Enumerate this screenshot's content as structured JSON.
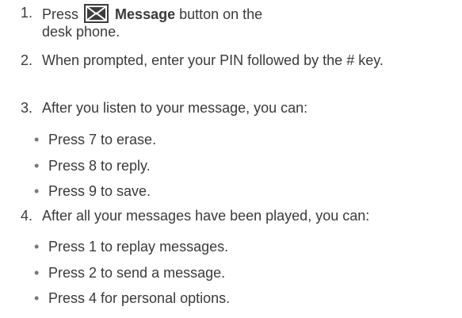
{
  "steps": [
    {
      "number": "1.",
      "before": "Press",
      "button_label": "Message",
      "after_line1": " button on the",
      "after_line2": "desk phone.",
      "icon": "envelope-icon"
    },
    {
      "number": "2.",
      "text": "When prompted, enter your PIN followed by the # key."
    },
    {
      "number": "3.",
      "text": "After you listen to your message, you can:",
      "bullets": [
        "Press 7 to erase.",
        "Press 8 to reply.",
        "Press 9 to save."
      ]
    },
    {
      "number": "4.",
      "text": "After all your messages have been played, you can:",
      "bullets": [
        "Press 1 to replay messages.",
        "Press 2 to send a message.",
        "Press 4 for personal options."
      ]
    }
  ],
  "bullet_symbol": "•",
  "colors": {
    "text": "#3a3a3a",
    "icon_bg": "#3c3c3c",
    "icon_line": "#ffffff"
  }
}
